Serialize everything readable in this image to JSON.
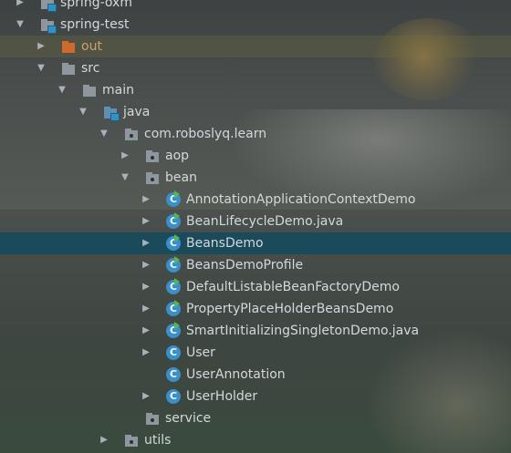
{
  "tree": [
    {
      "label": "spring-oxm",
      "level": 0,
      "arrow": "right",
      "icon": "module-folder",
      "state": "normal"
    },
    {
      "label": "spring-test",
      "level": 0,
      "arrow": "down",
      "icon": "module-folder",
      "state": "normal"
    },
    {
      "label": "out",
      "level": 1,
      "arrow": "right",
      "icon": "excluded-folder",
      "state": "excluded"
    },
    {
      "label": "src",
      "level": 1,
      "arrow": "down",
      "icon": "folder",
      "state": "normal"
    },
    {
      "label": "main",
      "level": 2,
      "arrow": "down",
      "icon": "folder",
      "state": "normal"
    },
    {
      "label": "java",
      "level": 3,
      "arrow": "down",
      "icon": "source-folder",
      "state": "normal"
    },
    {
      "label": "com.roboslyq.learn",
      "level": 4,
      "arrow": "down",
      "icon": "package",
      "state": "normal"
    },
    {
      "label": "aop",
      "level": 5,
      "arrow": "right",
      "icon": "package",
      "state": "normal"
    },
    {
      "label": "bean",
      "level": 5,
      "arrow": "down",
      "icon": "package",
      "state": "normal"
    },
    {
      "label": "AnnotationApplicationContextDemo",
      "level": 6,
      "arrow": "right",
      "icon": "class-runnable",
      "state": "normal"
    },
    {
      "label": "BeanLifecycleDemo.java",
      "level": 6,
      "arrow": "right",
      "icon": "class-runnable",
      "state": "normal"
    },
    {
      "label": "BeansDemo",
      "level": 6,
      "arrow": "right",
      "icon": "class-runnable",
      "state": "selected"
    },
    {
      "label": "BeansDemoProfile",
      "level": 6,
      "arrow": "right",
      "icon": "class-runnable",
      "state": "normal"
    },
    {
      "label": "DefaultListableBeanFactoryDemo",
      "level": 6,
      "arrow": "right",
      "icon": "class-runnable",
      "state": "normal"
    },
    {
      "label": "PropertyPlaceHolderBeansDemo",
      "level": 6,
      "arrow": "right",
      "icon": "class-runnable",
      "state": "normal"
    },
    {
      "label": "SmartInitializingSingletonDemo.java",
      "level": 6,
      "arrow": "right",
      "icon": "class-runnable",
      "state": "normal"
    },
    {
      "label": "User",
      "level": 6,
      "arrow": "right",
      "icon": "class",
      "state": "normal"
    },
    {
      "label": "UserAnnotation",
      "level": 6,
      "arrow": "none",
      "icon": "class",
      "state": "normal"
    },
    {
      "label": "UserHolder",
      "level": 6,
      "arrow": "right",
      "icon": "class",
      "state": "normal"
    },
    {
      "label": "service",
      "level": 5,
      "arrow": "none",
      "icon": "package",
      "state": "normal"
    },
    {
      "label": "utils",
      "level": 4,
      "arrow": "right",
      "icon": "package",
      "state": "normal"
    }
  ],
  "class_icon_letter": "C"
}
